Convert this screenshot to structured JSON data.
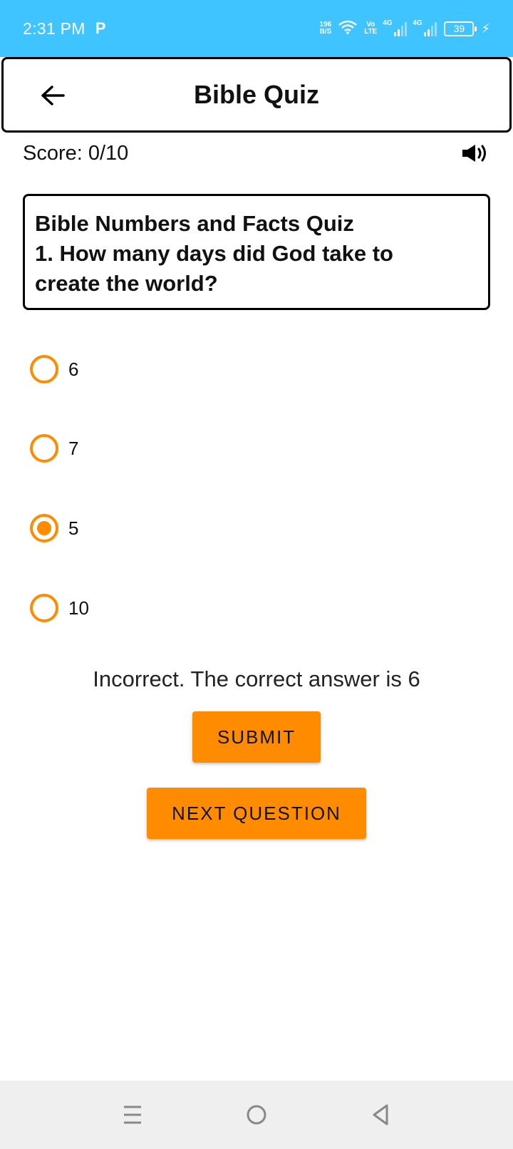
{
  "status_bar": {
    "time": "2:31 PM",
    "carrier_icon": "P",
    "net_speed_value": "196",
    "net_speed_unit": "B/S",
    "volte_top": "Vo",
    "volte_bottom": "LTE",
    "network_type_1": "4G",
    "network_type_2": "4G",
    "battery": "39"
  },
  "app_bar": {
    "title": "Bible Quiz"
  },
  "score": "Score: 0/10",
  "question": {
    "line1": "Bible Numbers and Facts Quiz",
    "line2": "1. How many days did God take to",
    "line3": "create the world?"
  },
  "options": [
    {
      "label": "6",
      "selected": false
    },
    {
      "label": "7",
      "selected": false
    },
    {
      "label": "5",
      "selected": true
    },
    {
      "label": "10",
      "selected": false
    }
  ],
  "feedback": "Incorrect. The correct answer is 6",
  "buttons": {
    "submit": "SUBMIT",
    "next": "NEXT QUESTION"
  },
  "colors": {
    "status_bar": "#40c4ff",
    "accent": "#ff8c00",
    "nav_bar": "#efefef"
  }
}
